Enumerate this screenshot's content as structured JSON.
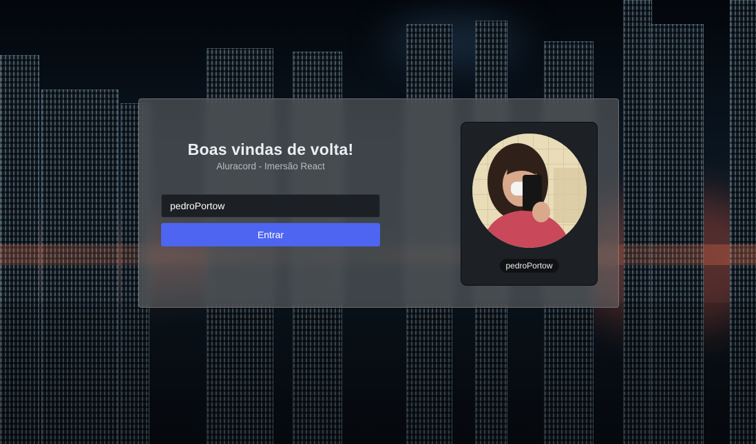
{
  "login": {
    "title": "Boas vindas de volta!",
    "subtitle": "Aluracord - Imersão React",
    "username_value": "pedroPortow",
    "submit_label": "Entrar"
  },
  "profile": {
    "username": "pedroPortow"
  },
  "colors": {
    "accent": "#4d65f0",
    "card_background": "#696c6e",
    "profile_panel": "#1d2024",
    "input_background": "#1c1f23"
  },
  "icons": [
    "avatar-photo"
  ]
}
